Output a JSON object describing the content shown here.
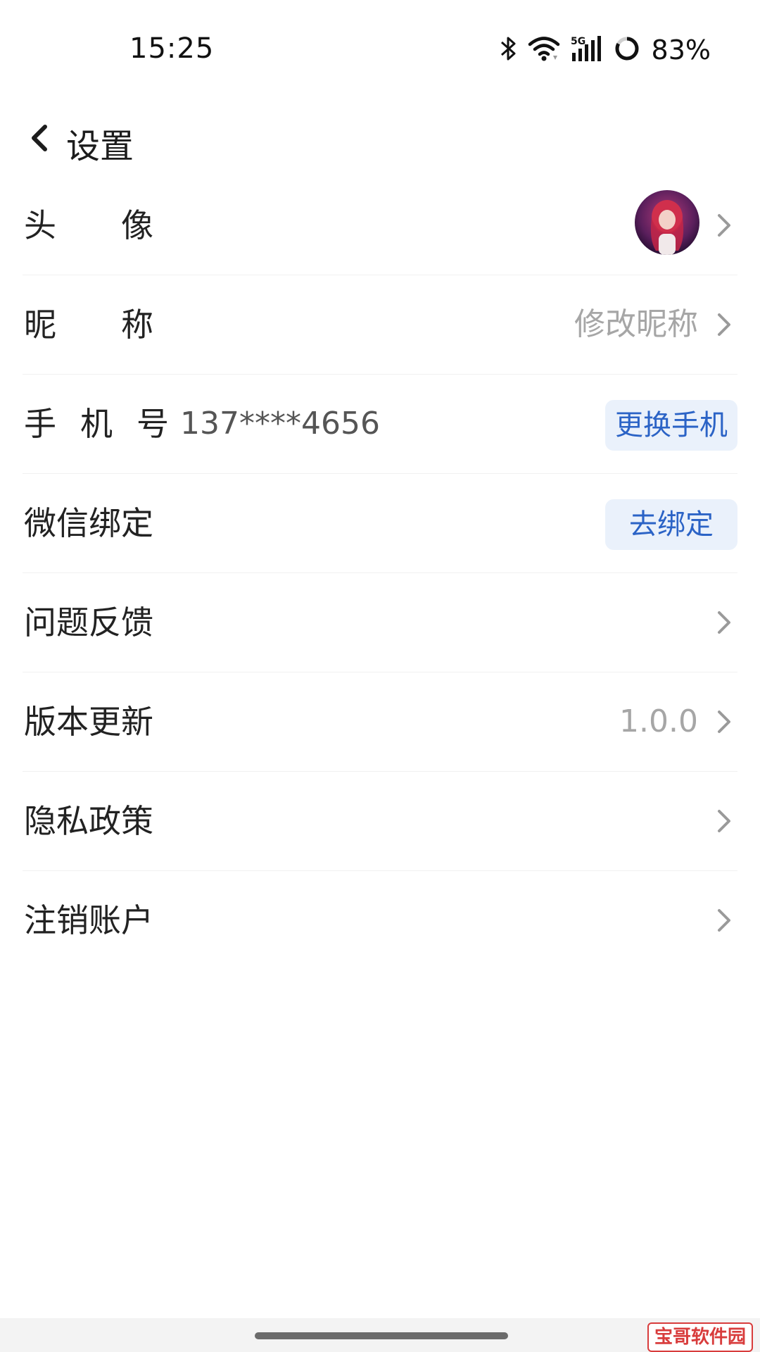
{
  "status_bar": {
    "time": "15:25",
    "battery_percent": "83%",
    "icons": [
      "bluetooth-icon",
      "wifi-icon",
      "5g-signal-icon",
      "battery-ring-icon"
    ]
  },
  "header": {
    "title": "设置",
    "back_icon": "chevron-left-icon"
  },
  "rows": {
    "avatar": {
      "label": "头像"
    },
    "nickname": {
      "label": "昵称",
      "value": "修改昵称"
    },
    "phone": {
      "label": "手机号",
      "value": "137****4656",
      "button": "更换手机"
    },
    "wechat": {
      "label": "微信绑定",
      "button": "去绑定"
    },
    "feedback": {
      "label": "问题反馈"
    },
    "version": {
      "label": "版本更新",
      "value": "1.0.0"
    },
    "privacy": {
      "label": "隐私政策"
    },
    "cancel_account": {
      "label": "注销账户"
    }
  },
  "colors": {
    "accent": "#2b63c6",
    "pill_bg": "#eaf1fb",
    "muted_text": "#a6a6a6"
  },
  "watermark": "宝哥软件园"
}
